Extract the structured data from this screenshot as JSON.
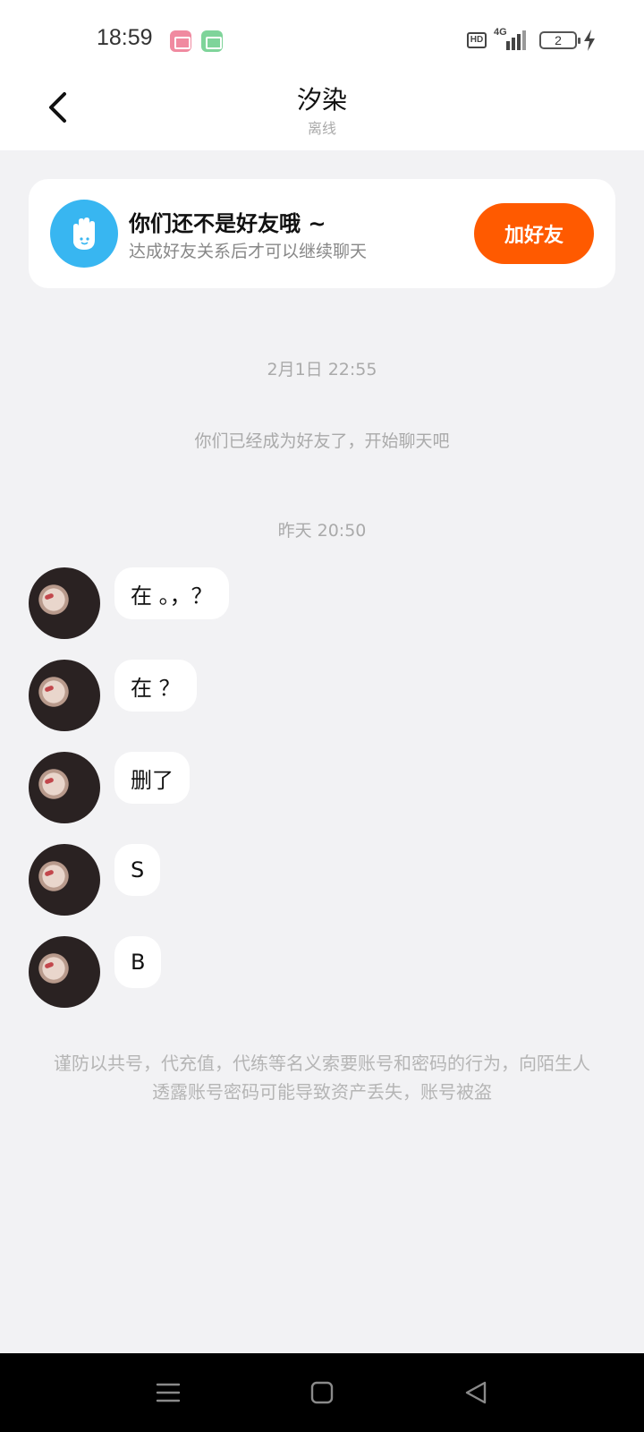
{
  "status_bar": {
    "time": "18:59",
    "network": "4G",
    "battery": "2"
  },
  "header": {
    "name": "汐染",
    "status": "离线"
  },
  "friend_banner": {
    "title": "你们还不是好友哦 ~",
    "subtitle": "达成好友关系后才可以继续聊天",
    "button_label": "加好友",
    "accent_color": "#ff5a00",
    "badge_color": "#38b6f1"
  },
  "timeline": {
    "timestamp_1": "2月1日 22:55",
    "system_message": "你们已经成为好友了，开始聊天吧",
    "timestamp_2": "昨天 20:50"
  },
  "messages": [
    {
      "text": "在 。，？"
    },
    {
      "text": "在 ？"
    },
    {
      "text": "删了"
    },
    {
      "text": "S"
    },
    {
      "text": "B"
    }
  ],
  "warning_text": "谨防以共号，代充值，代练等名义索要账号和密码的行为，向陌生人透露账号密码可能导致资产丢失，账号被盗"
}
